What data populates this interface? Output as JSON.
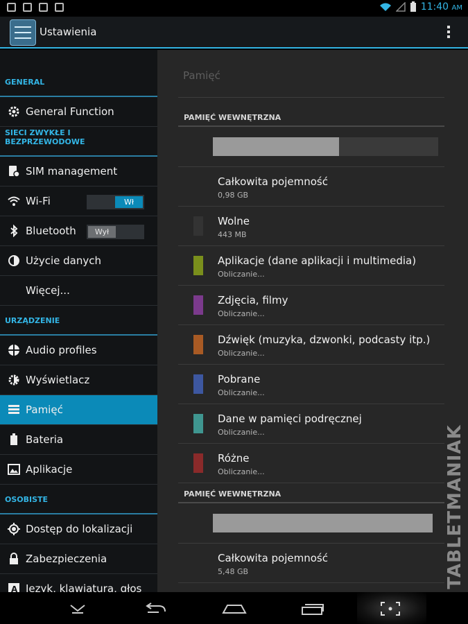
{
  "status": {
    "time": "11:40",
    "ampm": "AM"
  },
  "header": {
    "title": "Ustawienia"
  },
  "sidebar": {
    "sections": [
      {
        "title": "GENERAL",
        "items": [
          {
            "label": "General Function",
            "icon": "gear-icon"
          }
        ]
      },
      {
        "title": "SIECI ZWYKŁE I BEZPRZEWODOWE",
        "items": [
          {
            "label": "SIM management",
            "icon": "sim-settings-icon"
          },
          {
            "label": "Wi-Fi",
            "icon": "wifi-icon",
            "toggle": "Wł",
            "toggle_on": true
          },
          {
            "label": "Bluetooth",
            "icon": "bluetooth-icon",
            "toggle": "Wył",
            "toggle_on": false
          },
          {
            "label": "Użycie danych",
            "icon": "data-usage-icon"
          },
          {
            "label": "Więcej...",
            "icon": ""
          }
        ]
      },
      {
        "title": "URZĄDZENIE",
        "items": [
          {
            "label": "Audio profiles",
            "icon": "audio-profiles-icon"
          },
          {
            "label": "Wyświetlacz",
            "icon": "display-icon"
          },
          {
            "label": "Pamięć",
            "icon": "storage-icon",
            "selected": true
          },
          {
            "label": "Bateria",
            "icon": "battery-icon"
          },
          {
            "label": "Aplikacje",
            "icon": "apps-icon"
          }
        ]
      },
      {
        "title": "OSOBISTE",
        "items": [
          {
            "label": "Dostęp do lokalizacji",
            "icon": "location-icon"
          },
          {
            "label": "Zabezpieczenia",
            "icon": "lock-icon"
          },
          {
            "label": "Język, klawiatura, głos",
            "icon": "language-icon"
          }
        ]
      }
    ]
  },
  "main": {
    "title": "Pamięć",
    "internal": {
      "header": "PAMIĘĆ WEWNĘTRZNA",
      "used_fraction": 0.56,
      "rows": [
        {
          "title": "Całkowita pojemność",
          "sub": "0,98 GB",
          "color": ""
        },
        {
          "title": "Wolne",
          "sub": "443 MB",
          "color": "#333333"
        },
        {
          "title": "Aplikacje (dane aplikacji i multimedia)",
          "sub": "Obliczanie...",
          "color": "#7a8f1c"
        },
        {
          "title": "Zdjęcia, filmy",
          "sub": "Obliczanie...",
          "color": "#7b3a8c"
        },
        {
          "title": "Dźwięk (muzyka, dzwonki, podcasty itp.)",
          "sub": "Obliczanie...",
          "color": "#a85a24"
        },
        {
          "title": "Pobrane",
          "sub": "Obliczanie...",
          "color": "#3d57a0"
        },
        {
          "title": "Dane w pamięci podręcznej",
          "sub": "Obliczanie...",
          "color": "#3f9690"
        },
        {
          "title": "Różne",
          "sub": "Obliczanie...",
          "color": "#8a2a2a"
        }
      ]
    },
    "internal2": {
      "header": "PAMIĘĆ WEWNĘTRZNA",
      "used_fraction": 1.0,
      "rows": [
        {
          "title": "Całkowita pojemność",
          "sub": "5,48 GB",
          "color": ""
        }
      ]
    }
  },
  "watermark": "TABLETMANIAK",
  "colors": {
    "accent": "#33b5e5",
    "selected": "#0b8ab8"
  }
}
